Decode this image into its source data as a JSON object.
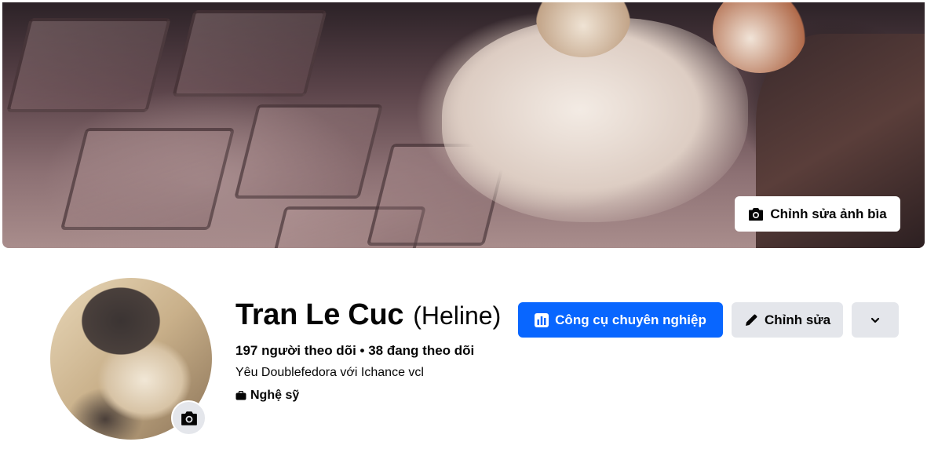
{
  "cover": {
    "edit_button_label": "Chỉnh sửa ảnh bìa",
    "camera_icon": "camera-icon"
  },
  "profile": {
    "name": "Tran Le Cuc",
    "alternate_name": "(Heline)",
    "stats": "197 người theo dõi • 38 đang theo dõi",
    "bio": "Yêu Doublefedora với Ichance vcl",
    "category": "Nghệ sỹ",
    "category_icon": "briefcase-icon"
  },
  "actions": {
    "pro_tools_label": "Công cụ chuyên nghiệp",
    "edit_label": "Chỉnh sửa",
    "more_icon": "chevron-down-icon"
  },
  "colors": {
    "primary": "#0866ff",
    "secondary_button": "#e4e6eb",
    "text": "#050505"
  }
}
